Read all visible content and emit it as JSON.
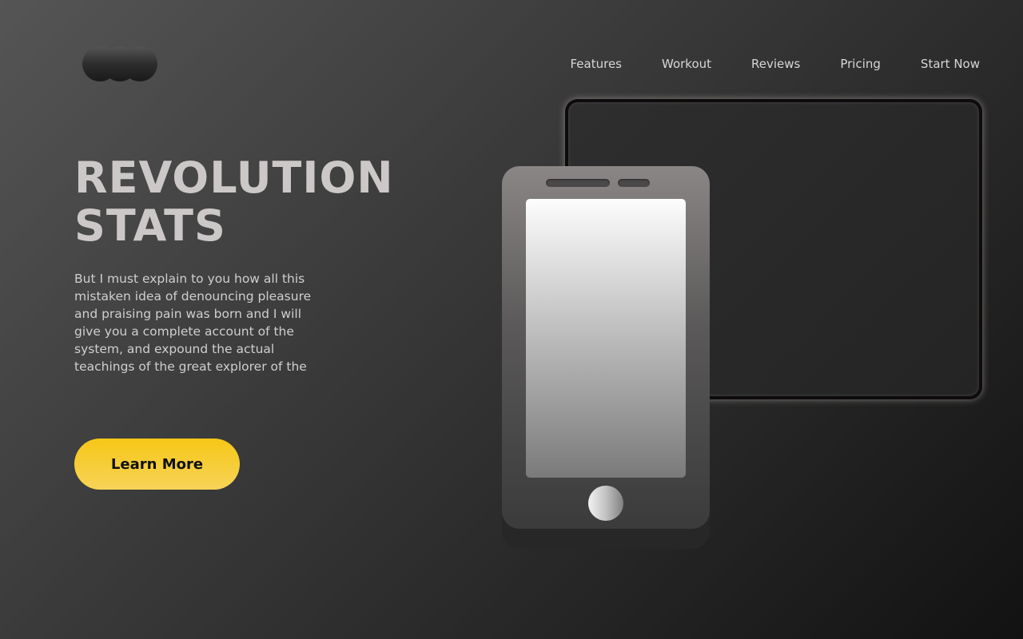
{
  "brand": {
    "logo_icon": "three-circles-logo"
  },
  "nav": {
    "items": [
      {
        "label": "Features"
      },
      {
        "label": "Workout"
      },
      {
        "label": "Reviews"
      },
      {
        "label": "Pricing"
      },
      {
        "label": "Start Now"
      }
    ]
  },
  "hero": {
    "title_line1": "REVOLUTION",
    "title_line2": "STATS",
    "body": "But I must explain to you how all this mistaken idea of denouncing pleasure and praising pain was born and I will give you a complete account of the system, and expound the actual teachings of the great explorer of the",
    "cta_label": "Learn More"
  },
  "colors": {
    "accent": "#f6c717",
    "title": "#ccc8c8",
    "text": "#cfcfcf",
    "background_start": "#555555",
    "background_end": "#121212"
  }
}
